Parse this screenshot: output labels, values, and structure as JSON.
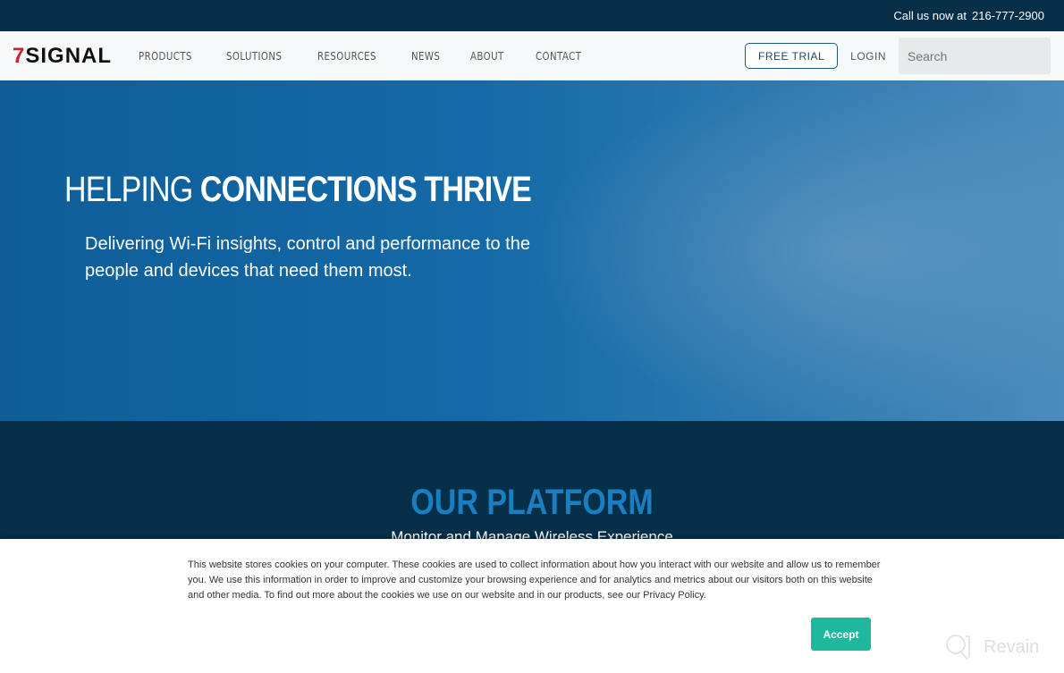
{
  "topbar": {
    "call_label": "Call us now at",
    "phone": "216-777-2900"
  },
  "nav": {
    "logo_digit": "7",
    "logo_text": "SIGNAL",
    "items": [
      "PRODUCTS",
      "SOLUTIONS",
      "RESOURCES",
      "NEWS",
      "ABOUT",
      "CONTACT"
    ],
    "free_trial": "FREE TRIAL",
    "login": "LOGIN",
    "search_placeholder": "Search"
  },
  "hero": {
    "title_light": "HELPING",
    "title_bold": "CONNECTIONS THRIVE",
    "subtitle": "Delivering Wi-Fi insights, control and performance to the people and devices that need them most."
  },
  "platform": {
    "title": "OUR PLATFORM",
    "subtitle": "Monitor and Manage Wireless Experience"
  },
  "cookie": {
    "text": "This website stores cookies on your computer. These cookies are used to collect information about how you interact with our website and allow us to remember you. We use this information in order to improve and customize your browsing experience and for analytics and metrics about our visitors both on this website and other media. To find out more about the cookies we use on our website and in our products, see our Privacy Policy.",
    "accept": "Accept"
  },
  "watermark": {
    "text": "Revain"
  },
  "colors": {
    "dark_navy": "#06304a",
    "hero_blue": "#146aa8",
    "accent_blue": "#1a7fc0",
    "accept_green": "#1eb89f",
    "logo_red": "#c8242c"
  }
}
